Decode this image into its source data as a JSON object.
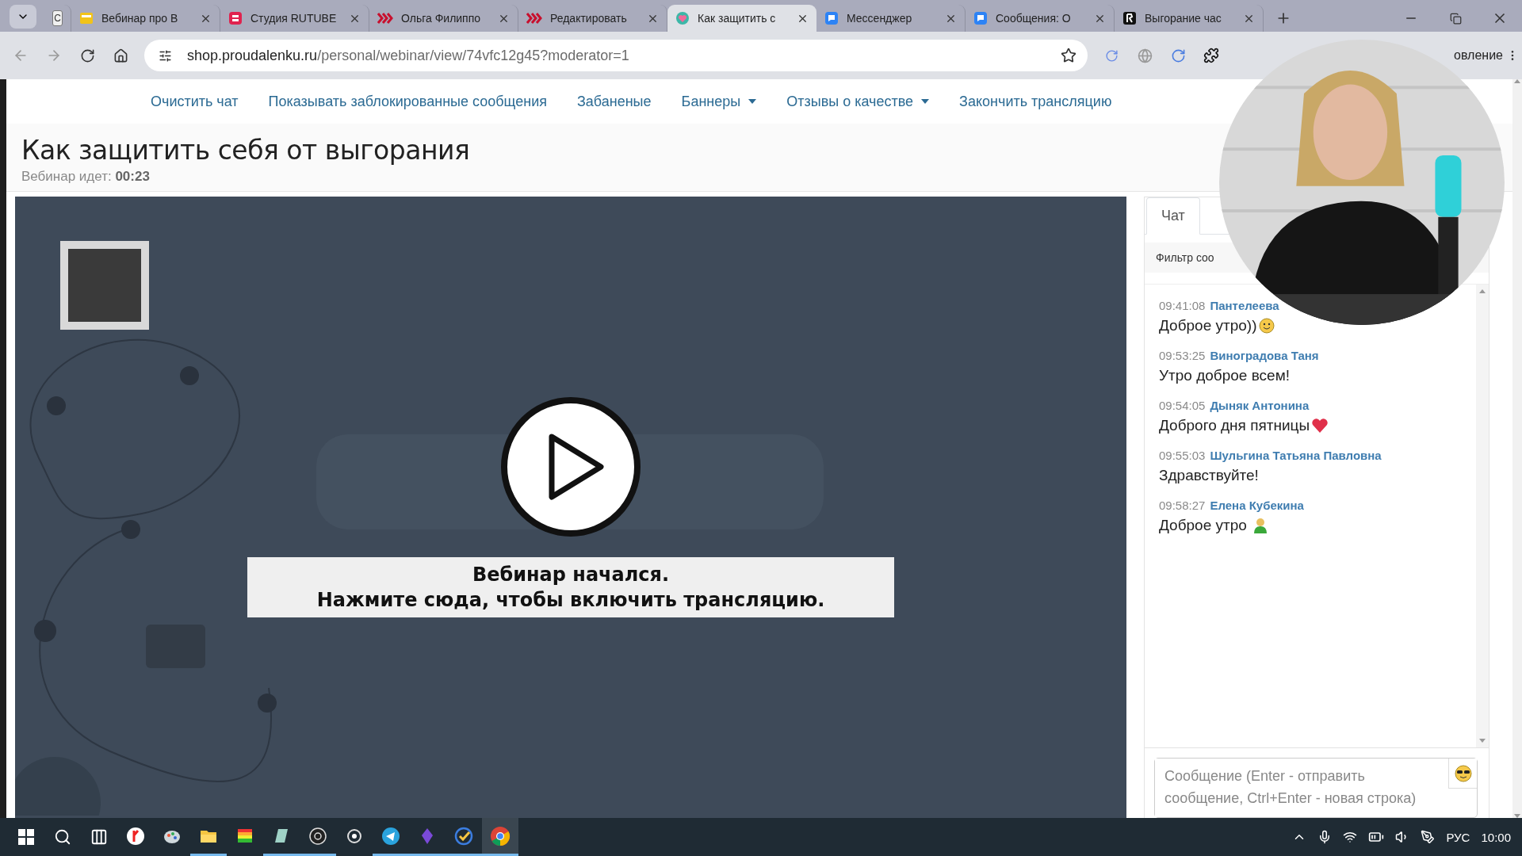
{
  "browser": {
    "tabs": [
      {
        "kind": "pinned",
        "label": "С",
        "selected": false
      },
      {
        "kind": "note",
        "label": "Вебинар про В",
        "selected": false
      },
      {
        "kind": "studio",
        "label": "Студия RUTUBE",
        "selected": false
      },
      {
        "kind": "chevrons",
        "label": "Ольга Филиппо",
        "selected": false
      },
      {
        "kind": "chevrons",
        "label": "Редактировать",
        "selected": false
      },
      {
        "kind": "heart",
        "label": "Как защитить с",
        "selected": true
      },
      {
        "kind": "chat",
        "label": "Мессенджер",
        "selected": false
      },
      {
        "kind": "chat",
        "label": "Сообщения: О",
        "selected": false
      },
      {
        "kind": "r-logo",
        "label": "Выгорание час",
        "selected": false
      }
    ],
    "url": {
      "host": "shop.proudalenku.ru",
      "path": "/personal/webinar/view/74vfc12g45?moderator=1"
    },
    "profile_button": "овление"
  },
  "nav": [
    {
      "label": "Очистить чат",
      "dropdown": false
    },
    {
      "label": "Показывать заблокированные сообщения",
      "dropdown": false
    },
    {
      "label": "Забаненые",
      "dropdown": false
    },
    {
      "label": "Баннеры",
      "dropdown": true
    },
    {
      "label": "Отзывы о качестве",
      "dropdown": true
    },
    {
      "label": "Закончить трансляцию",
      "dropdown": false
    }
  ],
  "page": {
    "title": "Как защитить себя от выгорания",
    "status": "Вебинар идет: **00:23**"
  },
  "player": {
    "kind": "picture",
    "banner": [
      "Вебинар начался.",
      "Нажмите сюда, чтобы включить трансляцию."
    ]
  },
  "chat": {
    "tabs": [
      {
        "label": "Чат",
        "selected": true
      }
    ],
    "filter": {
      "placeholder": "Фильтр соо"
    },
    "messages": [
      {
        "time": "09:41:08",
        "author": "Пантелеева",
        "text": "Доброе утро))",
        "kind": "smile"
      },
      {
        "time": "09:53:25",
        "author": "Виноградова Таня",
        "text": "Утро доброе всем!",
        "kind": "plain"
      },
      {
        "time": "09:54:05",
        "author": "Дыняк Антонина",
        "text": "Доброго дня пятницы",
        "kind": "heart"
      },
      {
        "time": "09:55:03",
        "author": "Шульгина Татьяна Павловна",
        "text": "Здравствуйте!",
        "kind": "plain"
      },
      {
        "time": "09:58:27",
        "author": "Елена Кубекина",
        "text": "Доброе утро ",
        "kind": "figure"
      }
    ],
    "input": {
      "placeholder": "Сообщение (Enter - отправить сообщение, Ctrl+Enter - новая строка)"
    }
  },
  "taskbar": {
    "apps": [
      {
        "kind": "yandex",
        "running": false,
        "selected": false
      },
      {
        "kind": "paint",
        "running": false,
        "selected": false
      },
      {
        "kind": "folder",
        "running": true,
        "selected": false
      },
      {
        "kind": "rainbow",
        "running": false,
        "selected": false
      },
      {
        "kind": "notes",
        "running": true,
        "selected": false
      },
      {
        "kind": "obs",
        "running": true,
        "selected": false
      },
      {
        "kind": "camera",
        "running": false,
        "selected": false
      },
      {
        "kind": "telegram",
        "running": true,
        "selected": false
      },
      {
        "kind": "crystal",
        "running": true,
        "selected": false
      },
      {
        "kind": "tick",
        "running": true,
        "selected": false
      },
      {
        "kind": "chrome",
        "running": true,
        "selected": true
      }
    ],
    "language": "РУС",
    "clock": "10:00"
  }
}
